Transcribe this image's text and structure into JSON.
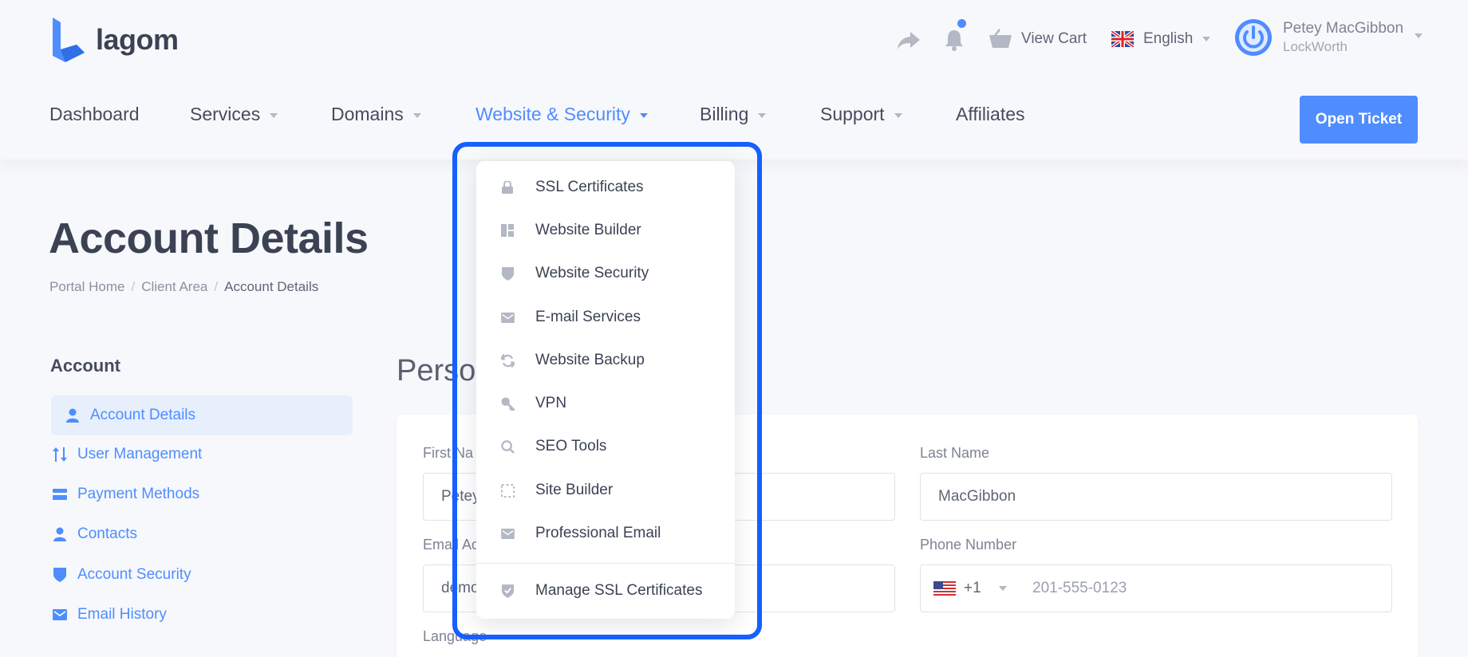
{
  "brand": {
    "name": "lagom",
    "accent": "#4f8dff",
    "highlight": "#1560ff"
  },
  "topbar": {
    "share_icon": "share-icon",
    "bell_icon": "bell-icon",
    "cart_icon": "basket-icon",
    "cart_label": "View Cart",
    "language": "English",
    "user_name": "Petey MacGibbon",
    "user_company": "LockWorth"
  },
  "nav": {
    "items": [
      {
        "label": "Dashboard"
      },
      {
        "label": "Services"
      },
      {
        "label": "Domains"
      },
      {
        "label": "Website & Security"
      },
      {
        "label": "Billing"
      },
      {
        "label": "Support"
      },
      {
        "label": "Affiliates"
      }
    ],
    "open_ticket": "Open Ticket"
  },
  "page": {
    "title": "Account Details",
    "breadcrumb": [
      "Portal Home",
      "Client Area",
      "Account Details"
    ],
    "section_title": "Person"
  },
  "sidebar": {
    "title": "Account",
    "items": [
      {
        "label": "Account Details",
        "icon": "user-icon"
      },
      {
        "label": "User Management",
        "icon": "users-sort-icon"
      },
      {
        "label": "Payment Methods",
        "icon": "card-icon"
      },
      {
        "label": "Contacts",
        "icon": "contact-icon"
      },
      {
        "label": "Account Security",
        "icon": "shield-icon"
      },
      {
        "label": "Email History",
        "icon": "envelope-icon"
      }
    ]
  },
  "form": {
    "first_name_label": "First Na",
    "first_name_value": "Petey",
    "last_name_label": "Last Name",
    "last_name_value": "MacGibbon",
    "email_label": "Email Ad",
    "email_value": "demo",
    "phone_label": "Phone Number",
    "phone_code": "+1",
    "phone_value": "201-555-0123",
    "language_label": "Language"
  },
  "dropdown": {
    "items": [
      {
        "label": "SSL Certificates",
        "icon": "lock-icon"
      },
      {
        "label": "Website Builder",
        "icon": "layout-icon"
      },
      {
        "label": "Website Security",
        "icon": "shield-icon"
      },
      {
        "label": "E-mail Services",
        "icon": "envelope-icon"
      },
      {
        "label": "Website Backup",
        "icon": "sync-icon"
      },
      {
        "label": "VPN",
        "icon": "key-icon"
      },
      {
        "label": "SEO Tools",
        "icon": "search-icon"
      },
      {
        "label": "Site Builder",
        "icon": "dashed-square-icon"
      },
      {
        "label": "Professional Email",
        "icon": "envelope-icon"
      }
    ],
    "manage_item": {
      "label": "Manage SSL Certificates",
      "icon": "shield-check-icon"
    }
  }
}
